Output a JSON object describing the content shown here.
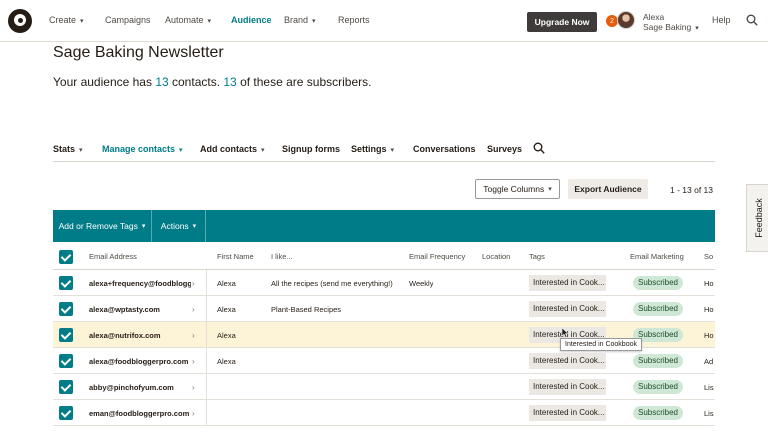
{
  "topnav": {
    "items": [
      {
        "label": "Create",
        "has_chevron": true
      },
      {
        "label": "Campaigns",
        "has_chevron": false
      },
      {
        "label": "Automate",
        "has_chevron": true
      },
      {
        "label": "Audience",
        "has_chevron": false,
        "active": true
      },
      {
        "label": "Brand",
        "has_chevron": true
      },
      {
        "label": "Reports",
        "has_chevron": false
      }
    ],
    "upgrade_label": "Upgrade Now",
    "notification_count": "2",
    "user_first": "Alexa",
    "user_org": "Sage Baking",
    "help_label": "Help",
    "search_icon": "search-icon"
  },
  "page": {
    "title": "Sage Baking Newsletter",
    "summary_prefix": "Your audience has ",
    "contact_count": "13",
    "summary_middle": " contacts. ",
    "subscriber_count": "13",
    "summary_suffix": " of these are subscribers."
  },
  "subnav": {
    "items": [
      {
        "label": "Stats",
        "chevron": true
      },
      {
        "label": "Manage contacts",
        "chevron": true,
        "active": true
      },
      {
        "label": "Add contacts",
        "chevron": true
      },
      {
        "label": "Signup forms",
        "chevron": false
      },
      {
        "label": "Settings",
        "chevron": true
      },
      {
        "label": "Conversations",
        "chevron": false
      },
      {
        "label": "Surveys",
        "chevron": false
      }
    ]
  },
  "toolbar": {
    "toggle_columns": "Toggle Columns",
    "export": "Export Audience",
    "pagination": "1 - 13 of 13"
  },
  "action_bar": {
    "tags": "Add or Remove Tags",
    "actions": "Actions"
  },
  "table": {
    "headers": {
      "email": "Email Address",
      "first_name": "First Name",
      "i_like": "I like...",
      "frequency": "Email Frequency",
      "location": "Location",
      "tags": "Tags",
      "marketing": "Email Marketing",
      "source": "So"
    },
    "rows": [
      {
        "email": "alexa+frequency@foodblogg...",
        "first_name": "Alexa",
        "i_like": "All the recipes (send me everything!)",
        "frequency": "Weekly",
        "tag": "Interested in Cook...",
        "status": "Subscribed",
        "source": "Ho"
      },
      {
        "email": "alexa@wptasty.com",
        "first_name": "Alexa",
        "i_like": "Plant-Based Recipes",
        "frequency": "",
        "tag": "Interested in Cook...",
        "status": "Subscribed",
        "source": "Ho"
      },
      {
        "email": "alexa@nutrifox.com",
        "first_name": "Alexa",
        "i_like": "",
        "frequency": "",
        "tag": "Interested in Cook...",
        "status": "Subscribed",
        "source": "Ho"
      },
      {
        "email": "alexa@foodbloggerpro.com",
        "first_name": "Alexa",
        "i_like": "",
        "frequency": "",
        "tag": "Interested in Cook...",
        "status": "Subscribed",
        "source": "Ad"
      },
      {
        "email": "abby@pinchofyum.com",
        "first_name": "",
        "i_like": "",
        "frequency": "",
        "tag": "Interested in Cook...",
        "status": "Subscribed",
        "source": "Lis"
      },
      {
        "email": "eman@foodbloggerpro.com",
        "first_name": "",
        "i_like": "",
        "frequency": "",
        "tag": "Interested in Cook...",
        "status": "Subscribed",
        "source": "Lis"
      }
    ]
  },
  "tooltip": "Interested in Cookbook",
  "feedback_label": "Feedback",
  "colors": {
    "accent": "#007c89",
    "highlight_row": "#fdf4d8",
    "subscribed_bg": "#cfe8d5",
    "upgrade_bg": "#403b3b"
  }
}
